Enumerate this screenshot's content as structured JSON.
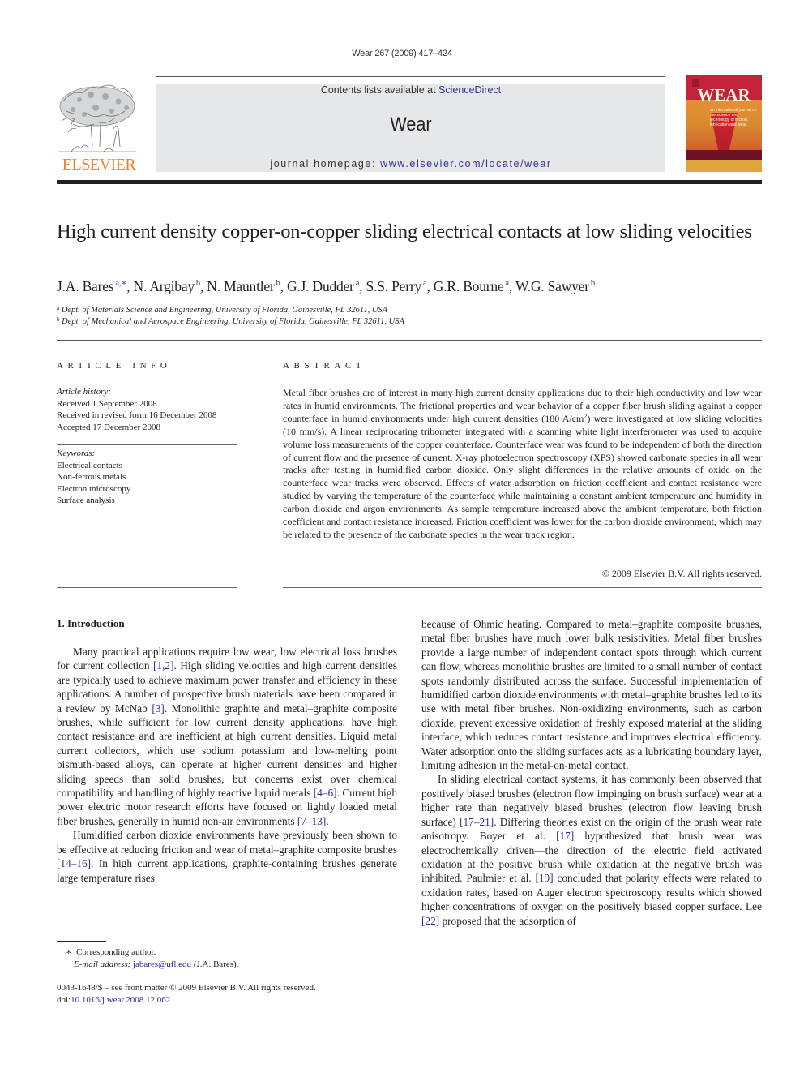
{
  "running_header": "Wear 267 (2009) 417–424",
  "masthead": {
    "publisher_logo_text": "ELSEVIER",
    "contents_prefix": "Contents lists available at ",
    "contents_link": "ScienceDirect",
    "journal_name": "Wear",
    "homepage_prefix": "journal homepage: ",
    "homepage_link": "www.elsevier.com/locate/wear",
    "cover_title": "WEAR",
    "cover_subtitle": "an international journal on the science and technology of friction, lubrication and wear",
    "colors": {
      "elsevier_orange": "#f47f24",
      "link_blue": "#2e3192",
      "band_gray": "#e6e7e8",
      "cover_red": "#c4213a"
    }
  },
  "article": {
    "title": "High current density copper-on-copper sliding electrical contacts at low sliding velocities",
    "authors": [
      {
        "name": "J.A. Bares",
        "affil": "a,∗"
      },
      {
        "name": "N. Argibay",
        "affil": "b"
      },
      {
        "name": "N. Mauntler",
        "affil": "b"
      },
      {
        "name": "G.J. Dudder",
        "affil": "a"
      },
      {
        "name": "S.S. Perry",
        "affil": "a"
      },
      {
        "name": "G.R. Bourne",
        "affil": "a"
      },
      {
        "name": "W.G. Sawyer",
        "affil": "b"
      }
    ],
    "affiliations": [
      {
        "mark": "a",
        "text": "Dept. of Materials Science and Engineering, University of Florida, Gainesville, FL 32611, USA"
      },
      {
        "mark": "b",
        "text": "Dept. of Mechanical and Aerospace Engineering, University of Florida, Gainesville, FL 32611, USA"
      }
    ]
  },
  "article_info": {
    "heading": "ARTICLE INFO",
    "history_label": "Article history:",
    "history": [
      "Received 1 September 2008",
      "Received in revised form 16 December 2008",
      "Accepted 17 December 2008"
    ],
    "keywords_label": "Keywords:",
    "keywords": [
      "Electrical contacts",
      "Non-ferrous metals",
      "Electron microscopy",
      "Surface analysis"
    ]
  },
  "abstract": {
    "heading": "ABSTRACT",
    "part1": "Metal fiber brushes are of interest in many high current density applications due to their high conductivity and low wear rates in humid environments. The frictional properties and wear behavior of a copper fiber brush sliding against a copper counterface in humid environments under high current densities (180 A/cm",
    "sup": "2",
    "part2": ") were investigated at low sliding velocities (10 mm/s). A linear reciprocating tribometer integrated with a scanning white light interferometer was used to acquire volume loss measurements of the copper counterface. Counterface wear was found to be independent of both the direction of current flow and the presence of current. X-ray photoelectron spectroscopy (XPS) showed carbonate species in all wear tracks after testing in humidified carbon dioxide. Only slight differences in the relative amounts of oxide on the counterface wear tracks were observed. Effects of water adsorption on friction coefficient and contact resistance were studied by varying the temperature of the counterface while maintaining a constant ambient temperature and humidity in carbon dioxide and argon environments. As sample temperature increased above the ambient temperature, both friction coefficient and contact resistance increased. Friction coefficient was lower for the carbon dioxide environment, which may be related to the presence of the carbonate species in the wear track region.",
    "copyright": "© 2009 Elsevier B.V. All rights reserved."
  },
  "body": {
    "section_heading": "1.  Introduction",
    "left_column": [
      {
        "segments": [
          {
            "t": "Many practical applications require low wear, low electrical loss brushes for current collection "
          },
          {
            "ref": "[1,2]"
          },
          {
            "t": ". High sliding velocities and high current densities are typically used to achieve maximum power transfer and efficiency in these applications. A number of prospective brush materials have been compared in a review by McNab "
          },
          {
            "ref": "[3]"
          },
          {
            "t": ". Monolithic graphite and metal–graphite composite brushes, while sufficient for low current density applications, have high contact resistance and are inefficient at high current densities. Liquid metal current collectors, which use sodium potassium and low-melting point bismuth-based alloys, can operate at higher current densities and higher sliding speeds than solid brushes, but concerns exist over chemical compatibility and handling of highly reactive liquid metals "
          },
          {
            "ref": "[4–6]"
          },
          {
            "t": ". Current high power electric motor research efforts have focused on lightly loaded metal fiber brushes, generally in humid non-air environments "
          },
          {
            "ref": "[7–13]"
          },
          {
            "t": "."
          }
        ]
      },
      {
        "segments": [
          {
            "t": "Humidified carbon dioxide environments have previously been shown to be effective at reducing friction and wear of metal–graphite composite brushes "
          },
          {
            "ref": "[14–16]"
          },
          {
            "t": ". In high current applications, graphite-containing brushes generate large temperature rises"
          }
        ]
      }
    ],
    "right_column": [
      {
        "noindent": true,
        "segments": [
          {
            "t": "because of Ohmic heating. Compared to metal–graphite composite brushes, metal fiber brushes have much lower bulk resistivities. Metal fiber brushes provide a large number of independent contact spots through which current can flow, whereas monolithic brushes are limited to a small number of contact spots randomly distributed across the surface. Successful implementation of humidified carbon dioxide environments with metal–graphite brushes led to its use with metal fiber brushes. Non-oxidizing environments, such as carbon dioxide, prevent excessive oxidation of freshly exposed material at the sliding interface, which reduces contact resistance and improves electrical efficiency. Water adsorption onto the sliding surfaces acts as a lubricating boundary layer, limiting adhesion in the metal-on-metal contact."
          }
        ]
      },
      {
        "segments": [
          {
            "t": "In sliding electrical contact systems, it has commonly been observed that positively biased brushes (electron flow impinging on brush surface) wear at a higher rate than negatively biased brushes (electron flow leaving brush surface) "
          },
          {
            "ref": "[17–21]"
          },
          {
            "t": ". Differing theories exist on the origin of the brush wear rate anisotropy. Boyer et al. "
          },
          {
            "ref": "[17]"
          },
          {
            "t": " hypothesized that brush wear was electrochemically driven—the direction of the electric field activated oxidation at the positive brush while oxidation at the negative brush was inhibited. Paulmier et al. "
          },
          {
            "ref": "[19]"
          },
          {
            "t": " concluded that polarity effects were related to oxidation rates, based on Auger electron spectroscopy results which showed higher concentrations of oxygen on the positively biased copper surface. Lee "
          },
          {
            "ref": "[22]"
          },
          {
            "t": " proposed that the adsorption of"
          }
        ]
      }
    ]
  },
  "footnotes": {
    "marker": "∗",
    "corresponding": "Corresponding author.",
    "email_label": "E-mail address: ",
    "email": "jabares@ufl.edu",
    "email_suffix": " (J.A. Bares).",
    "front_matter": "0043-1648/$ – see front matter © 2009 Elsevier B.V. All rights reserved.",
    "doi_prefix": "doi:",
    "doi": "10.1016/j.wear.2008.12.062"
  }
}
